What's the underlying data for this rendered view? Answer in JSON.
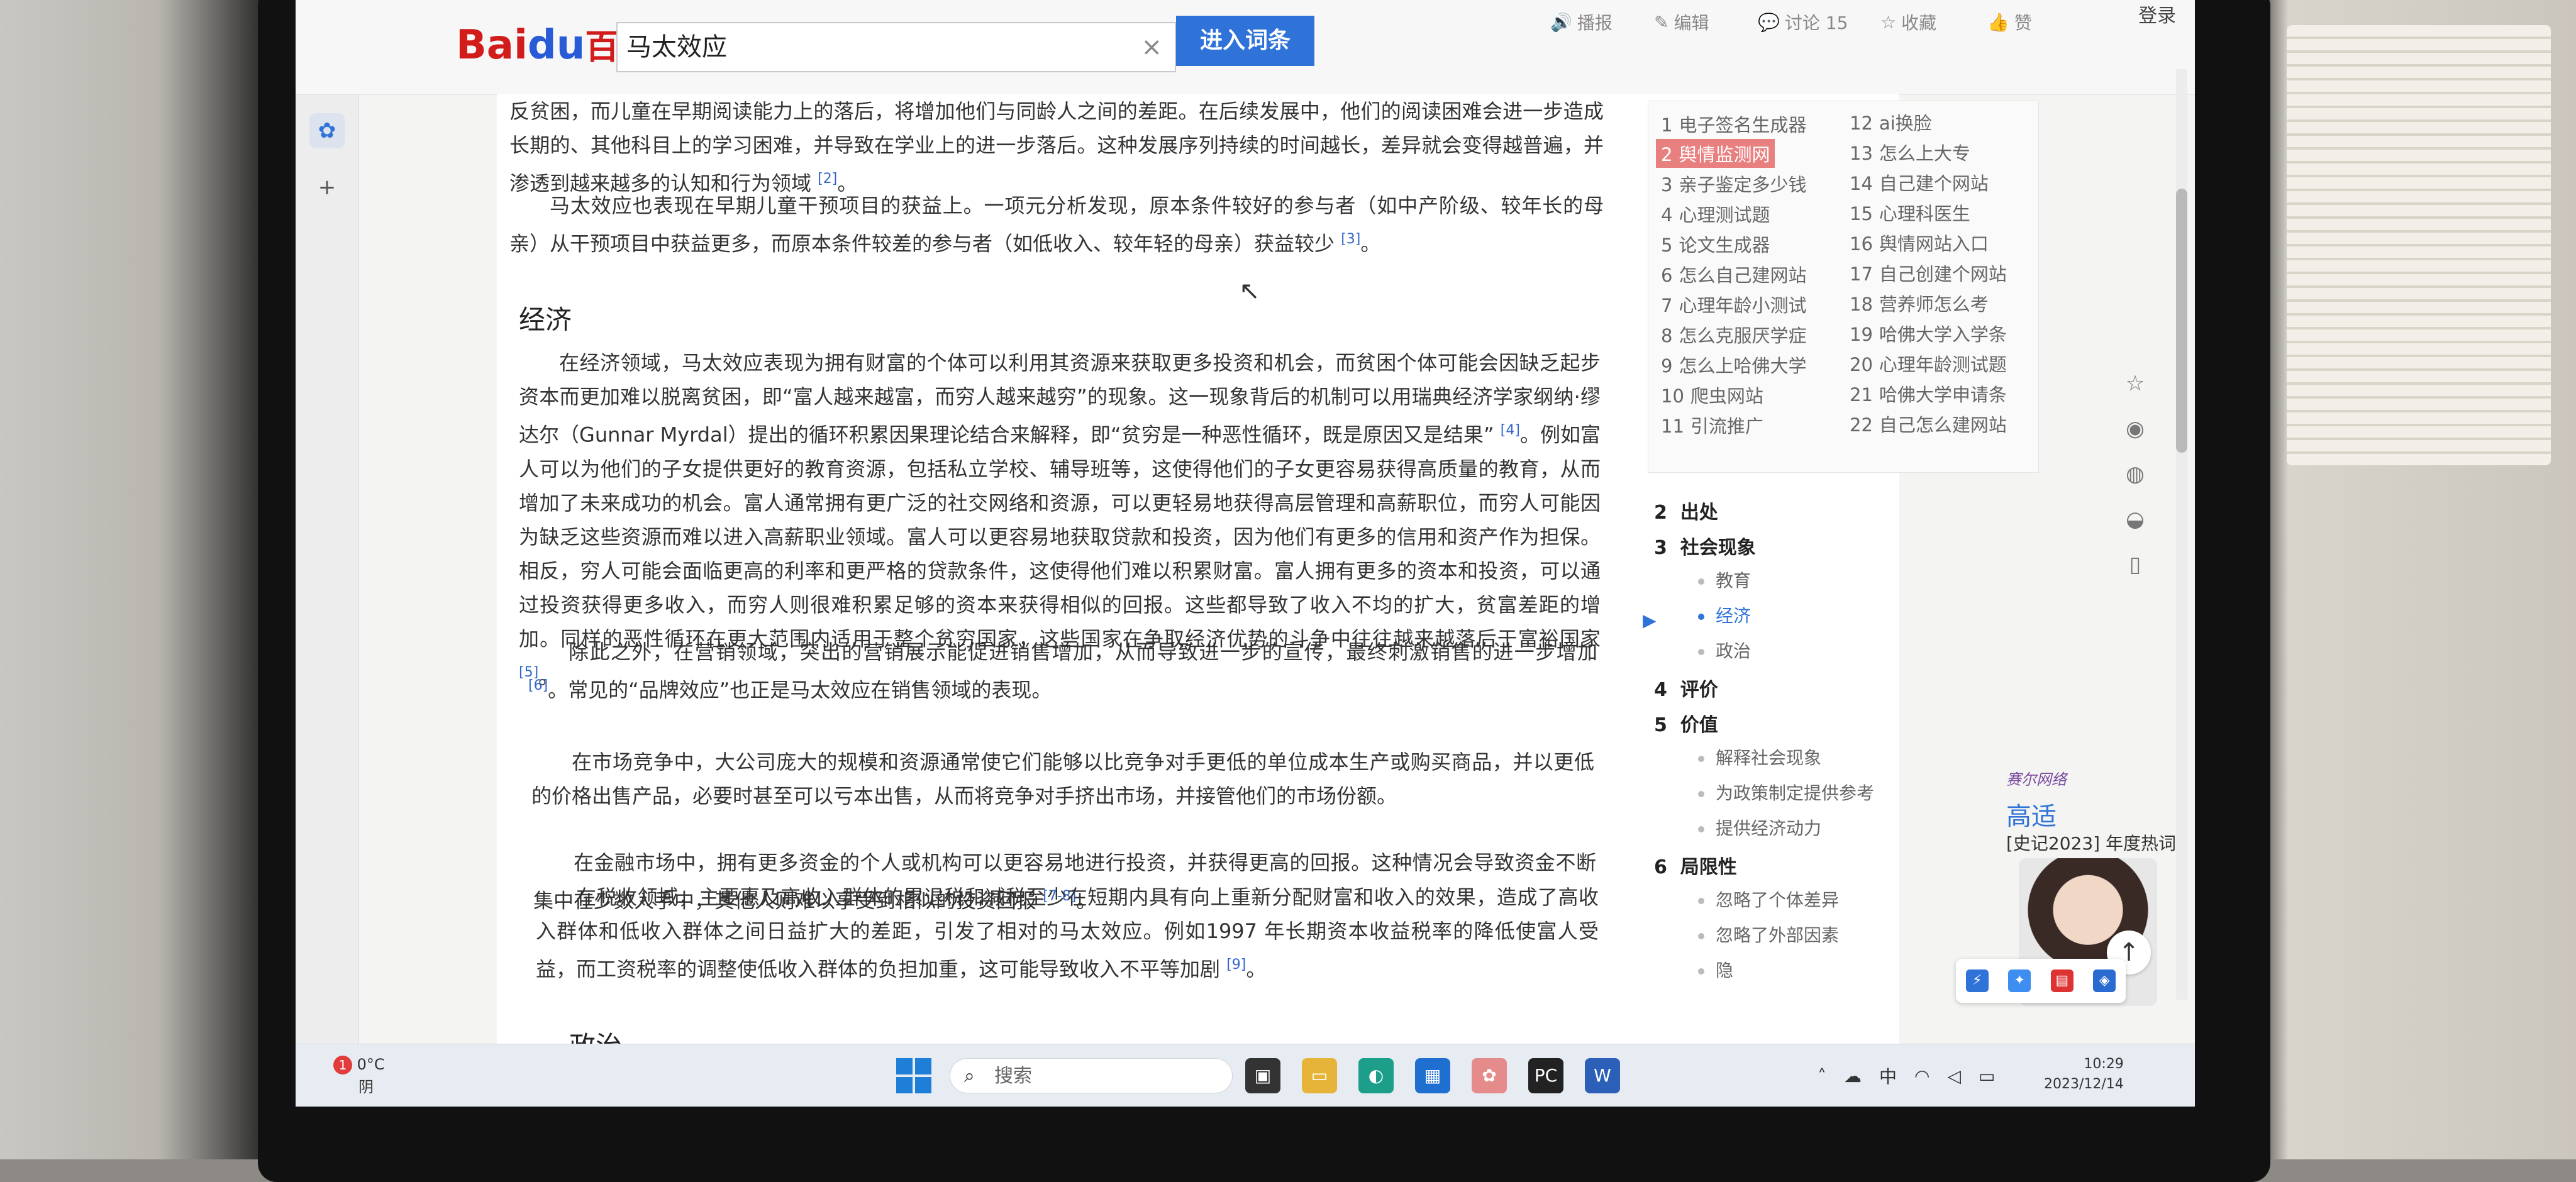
{
  "header": {
    "logo_bai": "Bai",
    "logo_du": "du",
    "logo_baike": "百科",
    "search_value": "马太效应",
    "clear_icon": "×",
    "enter_label": "进入词条",
    "actions": [
      {
        "icon": "🔊",
        "label": "播报"
      },
      {
        "icon": "✎",
        "label": "编辑"
      },
      {
        "icon": "💬",
        "label": "讨论 15"
      },
      {
        "icon": "☆",
        "label": "收藏"
      },
      {
        "icon": "👍",
        "label": "赞"
      }
    ],
    "login": "登录"
  },
  "article": {
    "p0": "反贫困，而儿童在早期阅读能力上的落后，将增加他们与同龄人之间的差距。在后续发展中，他们的阅读困难会进一步造成长期的、其他科目上的学习困难，并导致在学业上的进一步落后。这种发展序列持续的时间越长，差异就会变得越普遍，并渗透到越来越多的认知和行为领域",
    "p0_ref": "[2]",
    "p1": "马太效应也表现在早期儿童干预项目的获益上。一项元分析发现，原本条件较好的参与者（如中产阶级、较年长的母亲）从干预项目中获益更多，而原本条件较差的参与者（如低收入、较年轻的母亲）获益较少",
    "p1_ref": "[3]",
    "h_economy": "经济",
    "p2": "在经济领域，马太效应表现为拥有财富的个体可以利用其资源来获取更多投资和机会，而贫困个体可能会因缺乏起步资本而更加难以脱离贫困，即“富人越来越富，而穷人越来越穷”的现象。这一现象背后的机制可以用瑞典经济学家纲纳·缪达尔（Gunnar Myrdal）提出的循环积累因果理论结合来解释，即“贫穷是一种恶性循环，既是原因又是结果”",
    "p2_ref": "[4]",
    "p2b": "。例如富人可以为他们的子女提供更好的教育资源，包括私立学校、辅导班等，这使得他们的子女更容易获得高质量的教育，从而增加了未来成功的机会。富人通常拥有更广泛的社交网络和资源，可以更轻易地获得高层管理和高薪职位，而穷人可能因为缺乏这些资源而难以进入高薪职业领域。富人可以更容易地获取贷款和投资，因为他们有更多的信用和资产作为担保。相反，穷人可能会面临更高的利率和更严格的贷款条件，这使得他们难以积累财富。富人拥有更多的资本和投资，可以通过投资获得更多收入，而穷人则很难积累足够的资本来获得相似的回报。这些都导致了收入不均的扩大，贫富差距的增加。同样的恶性循环在更大范围内适用于整个贫穷国家，这些国家在争取经济优势的斗争中往往越来越落后于富裕国家",
    "p2b_ref": "[5]",
    "p3": "除此之外，在营销领域，突出的营销展示能促进销售增加，从而导致进一步的宣传，最终刺激销售的进一步增加",
    "p3_ref": "[6]",
    "p3b": "。常见的“品牌效应”也正是马太效应在销售领域的表现。",
    "p4": "在市场竞争中，大公司庞大的规模和资源通常使它们能够以比竞争对手更低的单位成本生产或购买商品，并以更低的价格出售产品，必要时甚至可以亏本出售，从而将竞争对手挤出市场，并接管他们的市场份额。",
    "p5": "在金融市场中，拥有更多资金的个人或机构可以更容易地进行投资，并获得更高的回报。这种情况会导致资金不断集中在少数人手中，其他人则难以享受到相似的投资回报",
    "p5_ref": "[7-8]",
    "p6": "在税收领域，主要惠及高收入群体的累退税和减税至少在短期内具有向上重新分配财富和收入的效果，造成了高收入群体和低收入群体之间日益扩大的差距，引发了相对的马太效应。例如1997 年长期资本收益税率的降低使富人受益，而工资税率的调整使低收入群体的负担加重，这可能导致收入不平等加剧",
    "p6_ref": "[9]",
    "h_politics": "政治"
  },
  "related": [
    {
      "n": "1",
      "t": "电子签名生成器"
    },
    {
      "n": "2",
      "t": "舆情监测网"
    },
    {
      "n": "3",
      "t": "亲子鉴定多少钱"
    },
    {
      "n": "4",
      "t": "心理测试题"
    },
    {
      "n": "5",
      "t": "论文生成器"
    },
    {
      "n": "6",
      "t": "怎么自己建网站"
    },
    {
      "n": "7",
      "t": "心理年龄小测试"
    },
    {
      "n": "8",
      "t": "怎么克服厌学症"
    },
    {
      "n": "9",
      "t": "怎么上哈佛大学"
    },
    {
      "n": "10",
      "t": "爬虫网站"
    },
    {
      "n": "11",
      "t": "引流推广"
    },
    {
      "n": "12",
      "t": "ai换脸"
    },
    {
      "n": "13",
      "t": "怎么上大专"
    },
    {
      "n": "14",
      "t": "自己建个网站"
    },
    {
      "n": "15",
      "t": "心理科医生"
    },
    {
      "n": "16",
      "t": "舆情网站入口"
    },
    {
      "n": "17",
      "t": "自己创建个网站"
    },
    {
      "n": "18",
      "t": "营养师怎么考"
    },
    {
      "n": "19",
      "t": "哈佛大学入学条"
    },
    {
      "n": "20",
      "t": "心理年龄测试题"
    },
    {
      "n": "21",
      "t": "哈佛大学申请条"
    },
    {
      "n": "22",
      "t": "自己怎么建网站"
    }
  ],
  "toc": {
    "s2_n": "2",
    "s2": "出处",
    "s3_n": "3",
    "s3": "社会现象",
    "s3a": "教育",
    "s3b": "经济",
    "s3c": "政治",
    "s4_n": "4",
    "s4": "评价",
    "s5_n": "5",
    "s5": "价值",
    "s5a": "解释社会现象",
    "s5b": "为政策制定提供参考",
    "s5c": "提供经济动力",
    "s6_n": "6",
    "s6": "局限性",
    "s6a": "忽略了个体差异",
    "s6b": "忽略了外部因素",
    "s6c": "隐"
  },
  "ad": {
    "brand": "赛尔网络",
    "name": "高适",
    "sub": "[史记2023] 年度热词"
  },
  "taskbar": {
    "weather_badge": "1",
    "weather_temp": "0°C",
    "weather_desc": "阴",
    "search_placeholder": "搜索",
    "tray_lang": "中",
    "time": "10:29",
    "date": "2023/12/14"
  },
  "colors": {
    "accent": "#2f73d9",
    "highlight": "#e98080",
    "logo_red": "#d21c1c"
  }
}
